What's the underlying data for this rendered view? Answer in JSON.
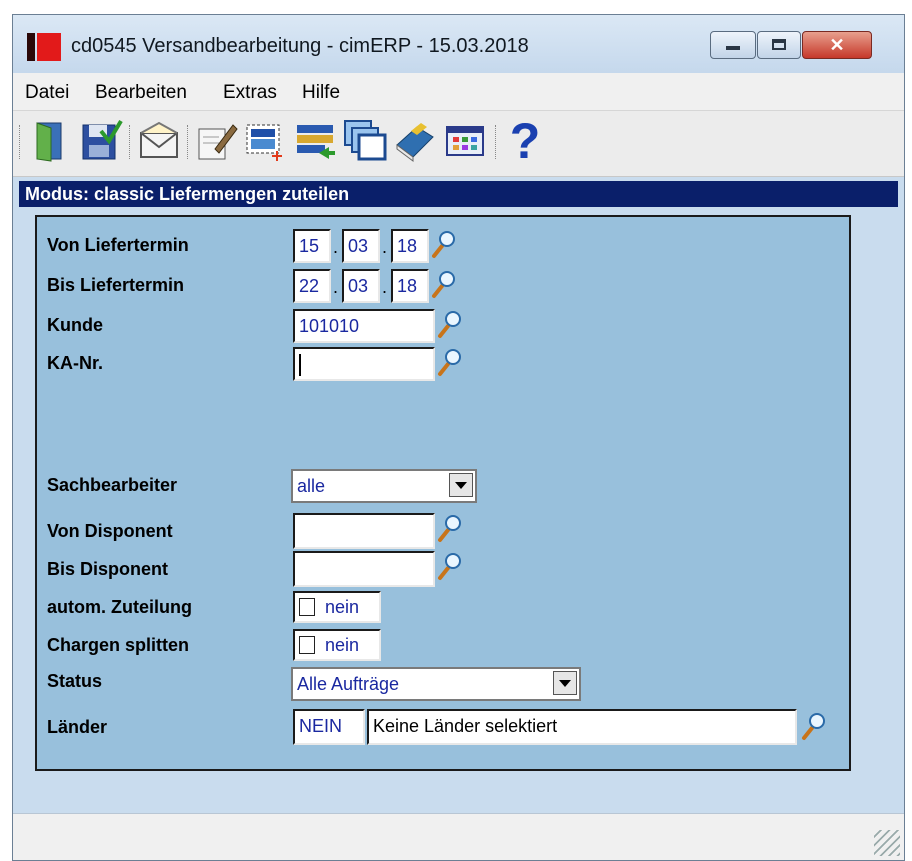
{
  "window": {
    "title": "cd0545 Versandbearbeitung - cimERP - 15.03.2018",
    "close_symbol": "✕"
  },
  "menu": [
    "Datei",
    "Bearbeiten",
    "Extras",
    "Hilfe"
  ],
  "toolbar_icons": [
    "exit-door-icon",
    "save-disk-icon",
    "mail-envelope-icon",
    "edit-pencil-icon",
    "new-record-icon",
    "list-transfer-icon",
    "windows-stack-icon",
    "book-icon",
    "grid-table-icon",
    "help-question-icon"
  ],
  "help_glyph": "?",
  "modus": "Modus: classic Liefermengen zuteilen",
  "form": {
    "von_liefertermin": {
      "label": "Von Liefertermin",
      "day": "15",
      "month": "03",
      "year": "18"
    },
    "bis_liefertermin": {
      "label": "Bis Liefertermin",
      "day": "22",
      "month": "03",
      "year": "18"
    },
    "date_sep": ".",
    "kunde": {
      "label": "Kunde",
      "value": "101010"
    },
    "ka_nr": {
      "label": "KA-Nr.",
      "value": ""
    },
    "sachbearbeiter": {
      "label": "Sachbearbeiter",
      "value": "alle"
    },
    "von_disponent": {
      "label": "Von Disponent",
      "value": ""
    },
    "bis_disponent": {
      "label": "Bis Disponent",
      "value": ""
    },
    "autom_zuteilung": {
      "label": "autom. Zuteilung",
      "value": "nein"
    },
    "chargen_splitten": {
      "label": "Chargen splitten",
      "value": "nein"
    },
    "status": {
      "label": "Status",
      "value": "Alle Aufträge"
    },
    "laender": {
      "label": "Länder",
      "code": "NEIN",
      "text": "Keine Länder selektiert"
    }
  },
  "colors": {
    "modus_bar": "#0a1f6a",
    "panel": "#98c0dc",
    "window": "#c9dcee",
    "field_text": "#1a28a0"
  }
}
